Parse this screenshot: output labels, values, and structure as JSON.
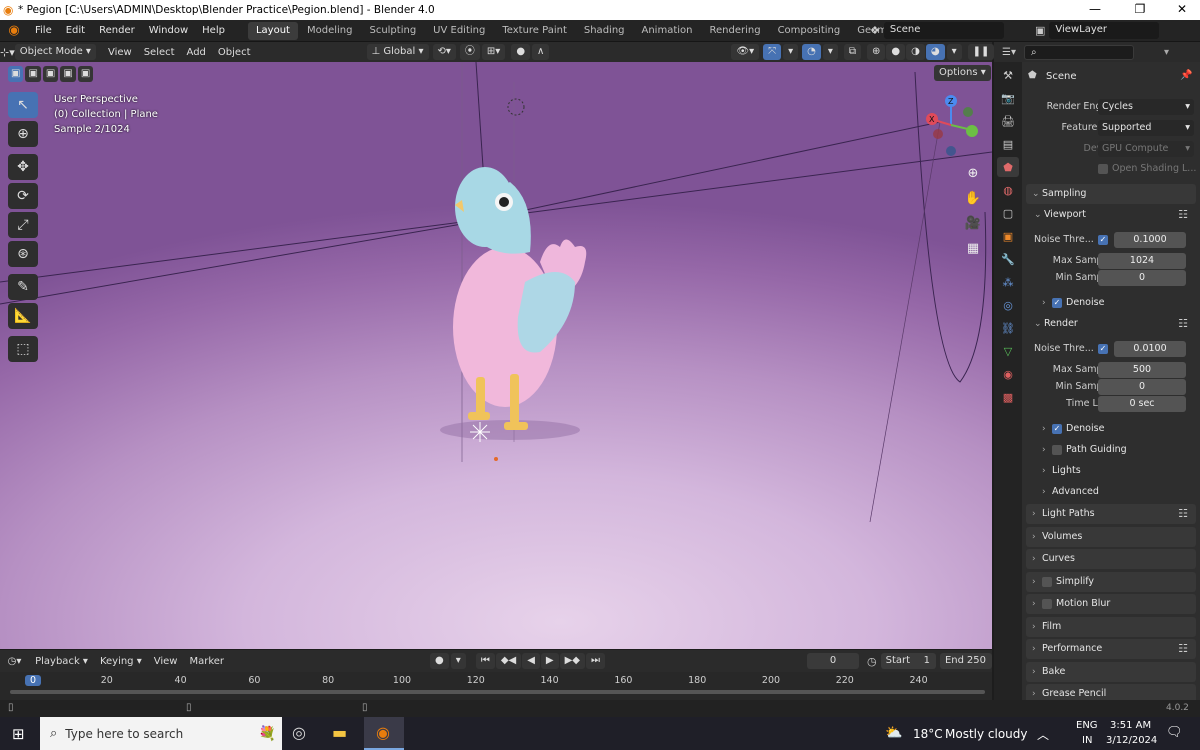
{
  "window": {
    "title": "* Pegion [C:\\Users\\ADMIN\\Desktop\\Blender Practice\\Pegion.blend] - Blender 4.0",
    "minimize": "—",
    "maximize": "❐",
    "close": "✕"
  },
  "menus": [
    "File",
    "Edit",
    "Render",
    "Window",
    "Help"
  ],
  "workspaces": [
    "Layout",
    "Modeling",
    "Sculpting",
    "UV Editing",
    "Texture Paint",
    "Shading",
    "Animation",
    "Rendering",
    "Compositing",
    "Geometry Nodes",
    "S"
  ],
  "scene_name": "Scene",
  "view_layer": "ViewLayer",
  "viewport_header": {
    "mode": "Object Mode",
    "view": "View",
    "select": "Select",
    "add": "Add",
    "object": "Object",
    "orientation": "Global",
    "options": "Options"
  },
  "viewport_overlay": {
    "line1": "User Perspective",
    "line2": "(0) Collection | Plane",
    "line3": "Sample 2/1024"
  },
  "properties": {
    "context": "Scene",
    "render_engine_label": "Render Engine",
    "render_engine": "Cycles",
    "feature_set_label": "Feature Set",
    "feature_set": "Supported",
    "device_label": "Device",
    "device": "GPU Compute",
    "open_shading": "Open Shading L...",
    "sampling": "Sampling",
    "viewport": "Viewport",
    "noise_thresh_label": "Noise Thre...",
    "vp_noise": "0.1000",
    "max_samples_label": "Max Samples",
    "min_samples_label": "Min Samples",
    "vp_max": "1024",
    "vp_min": "0",
    "denoise": "Denoise",
    "render": "Render",
    "r_noise": "0.0100",
    "r_max": "500",
    "r_min": "0",
    "time_limit_label": "Time Limit",
    "r_time": "0 sec",
    "path_guiding": "Path Guiding",
    "lights": "Lights",
    "advanced": "Advanced",
    "panels": [
      "Light Paths",
      "Volumes",
      "Curves",
      "Simplify",
      "Motion Blur",
      "Film",
      "Performance",
      "Bake",
      "Grease Pencil"
    ]
  },
  "timeline": {
    "playback": "Playback",
    "keying": "Keying",
    "view": "View",
    "marker": "Marker",
    "current": "0",
    "start_label": "Start",
    "start": "1",
    "end_label": "End",
    "end": "250",
    "ticks": [
      "0",
      "20",
      "40",
      "60",
      "80",
      "100",
      "120",
      "140",
      "160",
      "180",
      "200",
      "220",
      "240"
    ]
  },
  "version": "4.0.2",
  "taskbar": {
    "search": "Type here to search",
    "temp": "18°C",
    "weather": "Mostly cloudy",
    "lang1": "ENG",
    "lang2": "IN",
    "time": "3:51 AM",
    "date": "3/12/2024"
  }
}
